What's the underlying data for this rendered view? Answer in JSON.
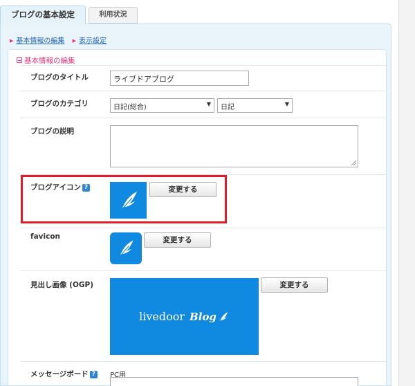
{
  "tabs": [
    {
      "label": "ブログの基本設定",
      "active": true
    },
    {
      "label": "利用状況",
      "active": false
    }
  ],
  "breadcrumb": [
    {
      "label": "基本情報の編集"
    },
    {
      "label": "表示設定"
    }
  ],
  "section_title": "基本情報の編集",
  "form": {
    "title_label": "ブログのタイトル",
    "title_value": "ライブドアブログ",
    "category_label": "ブログのカテゴリ",
    "category_main": "日記(総合)",
    "category_sub": "日記",
    "description_label": "ブログの説明",
    "icon_label": "ブログアイコン",
    "icon_change": "変更する",
    "favicon_label": "favicon",
    "favicon_change": "変更する",
    "ogp_label": "見出し画像 (OGP)",
    "ogp_change": "変更する",
    "ogp_logo_text": "livedoor",
    "ogp_logo_script": "Blog",
    "message_label": "メッセージボード",
    "message_pc_label": "PC用",
    "help_glyph": "?"
  },
  "colors": {
    "accent_pink": "#e5377f",
    "link_blue": "#2666b0",
    "icon_blue": "#1089e0",
    "highlight_red": "#e21c2a"
  }
}
